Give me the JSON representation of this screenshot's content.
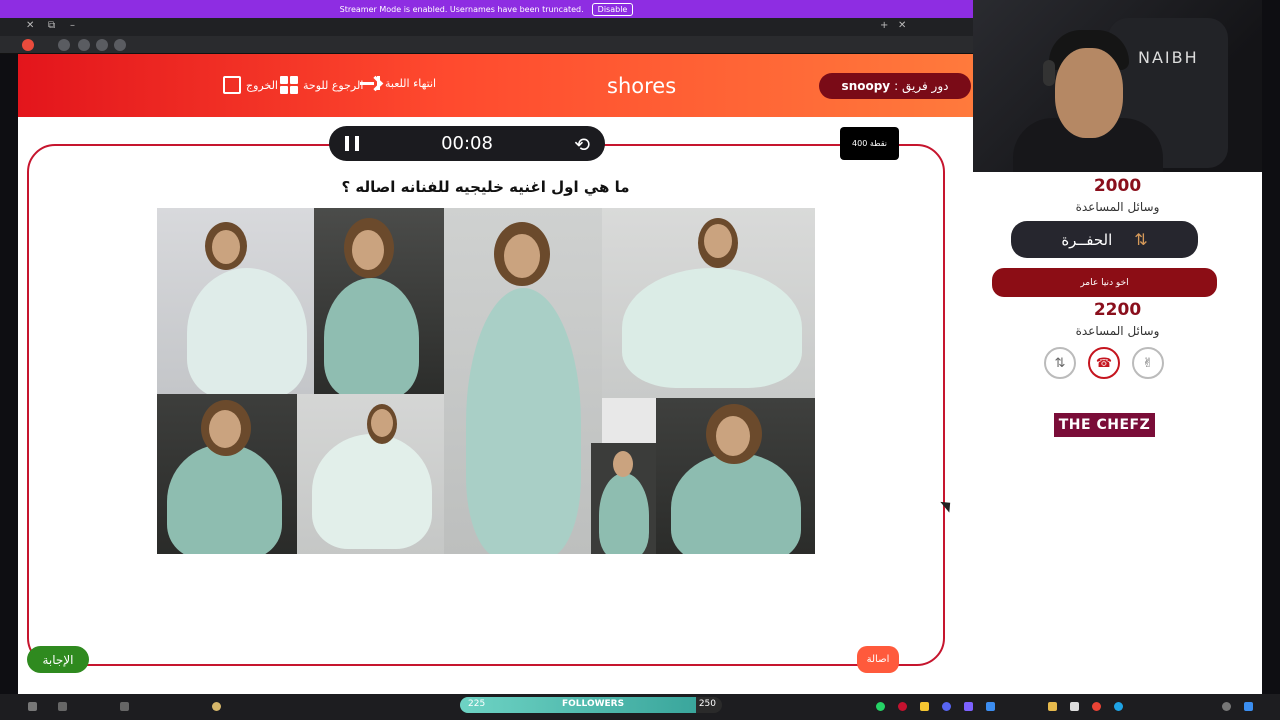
{
  "banner": {
    "text": "Streamer Mode is enabled. Usernames have been truncated.",
    "button": "Disable"
  },
  "header": {
    "exit_label": "الخروج",
    "back_label": "الرجوع للوحة",
    "end_label": "انتهاء اللعبة",
    "brand": "shores",
    "turn_prefix": "دور فريق :",
    "turn_team": "snoopy"
  },
  "game": {
    "timer": "00:08",
    "points_badge": "400 نقطة",
    "question": "ما هي اول اغنيه خليجيه للفنانه اصاله ؟",
    "answer_button": "الإجابة",
    "category_badge": "اصالة"
  },
  "side": {
    "team1_points": "2000",
    "team1_help_label": "وسائل المساعدة",
    "drill_label": "الحفــرة",
    "team2_name": "اخو دنيا عامر",
    "team2_points": "2200",
    "team2_help_label": "وسائل المساعدة",
    "sponsor": "THE CHEFZ"
  },
  "webcam": {
    "chair_text": "NAIBH"
  },
  "taskbar": {
    "followers_label": "FOLLOWERS",
    "followers_current": "225",
    "followers_goal": "250",
    "followers_progress": 0.9
  },
  "colors": {
    "header_start": "#e3151c",
    "header_end": "#ff7a3c",
    "dark_red": "#8c0d15",
    "answer_green": "#2f8a1f"
  },
  "icons": [
    "pause-icon",
    "reset-timer-icon",
    "exit-icon",
    "grid-icon",
    "end-arrow-icon",
    "drill-icon",
    "swap-icon",
    "phone-icon",
    "two-fingers-icon"
  ]
}
